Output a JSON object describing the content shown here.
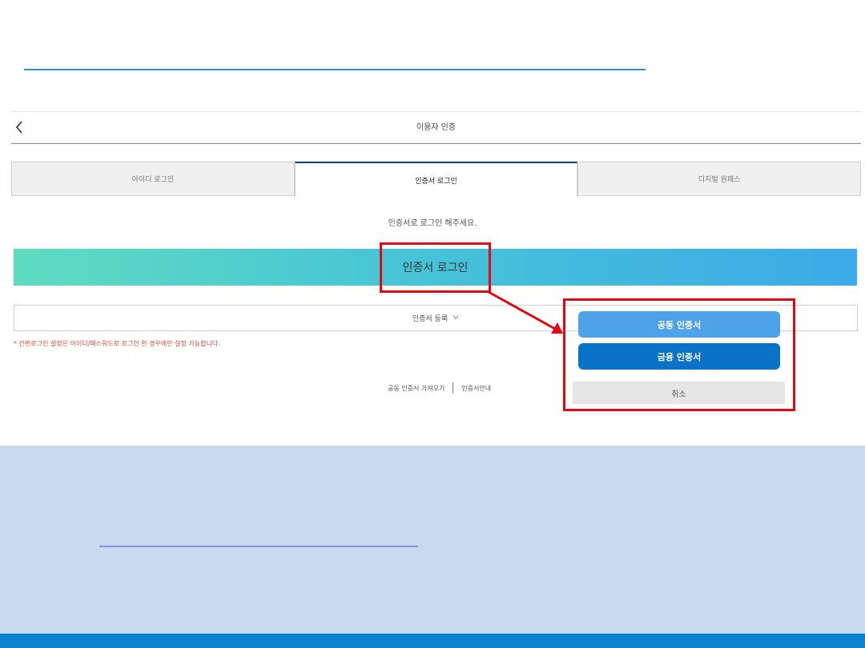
{
  "header": {
    "title": "이용자 인증",
    "back_icon": "chevron-left-icon"
  },
  "tabs": [
    {
      "label": "아이디 로그인",
      "active": false
    },
    {
      "label": "인증서 로그인",
      "active": true
    },
    {
      "label": "디지털 원패스",
      "active": false
    }
  ],
  "main": {
    "prompt": "인증서로 로그인 해주세요.",
    "cert_login_label": "인증서 로그인",
    "register_label": "인증서 등록",
    "notice": "* 간편로그인 설정은 아이디/패스워드로 로그인 한 경우에만 설정 가능합니다.",
    "link_import": "공동 인증서 가져오기",
    "link_guide": "인증서안내"
  },
  "popup": {
    "gong_label": "공동 인증서",
    "geum_label": "금융 인증서",
    "cancel_label": "취소"
  },
  "colors": {
    "accent_red": "#e30613",
    "blue_dark": "#0a73c8",
    "blue_light": "#4ea3e8",
    "footer_bg": "#c8daf0"
  }
}
